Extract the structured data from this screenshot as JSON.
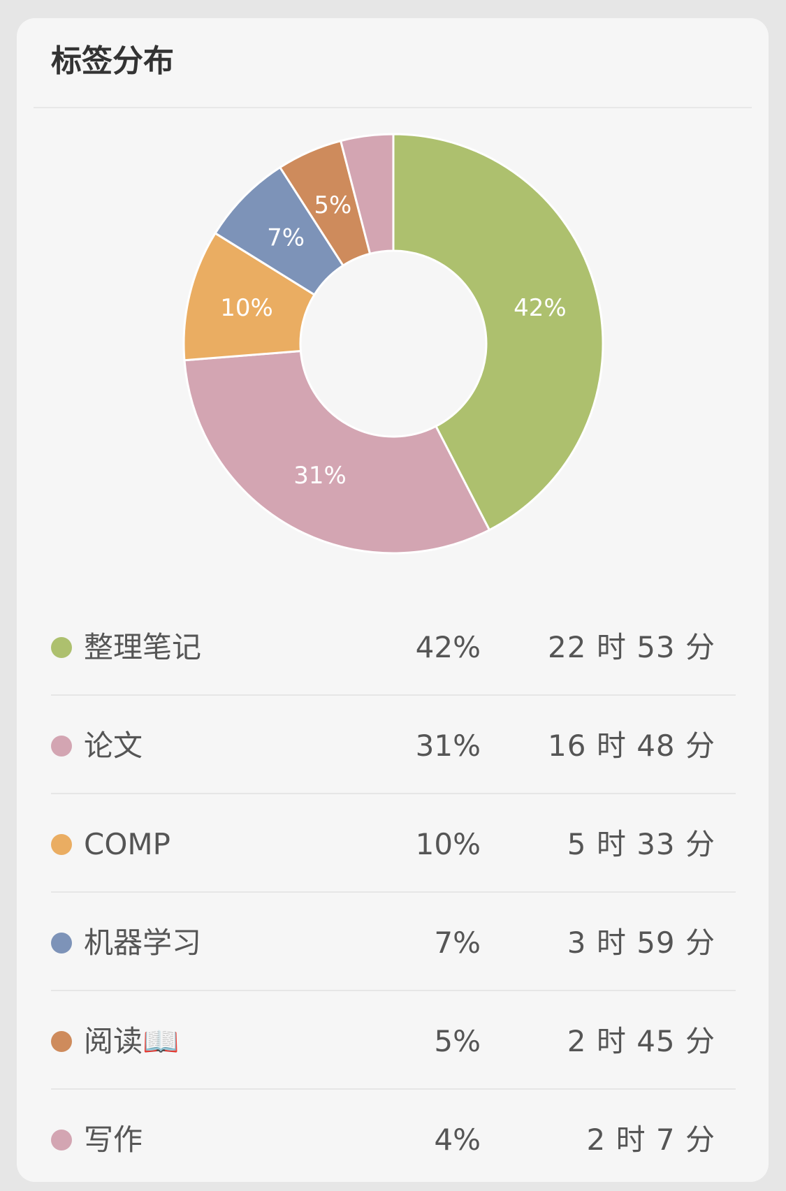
{
  "card": {
    "title": "标签分布"
  },
  "chart_data": {
    "type": "pie",
    "title": "",
    "categories": [
      "整理笔记",
      "论文",
      "COMP",
      "机器学习",
      "阅读📖",
      "写作"
    ],
    "values": [
      42,
      31,
      10,
      7,
      5,
      4
    ],
    "percent_labels": [
      "42%",
      "31%",
      "10%",
      "7%",
      "5%",
      ""
    ],
    "colors": [
      "#adc06e",
      "#d3a5b2",
      "#eaad62",
      "#7d93b8",
      "#ce8b5c",
      "#d3a5b2"
    ],
    "donut": true
  },
  "legend": {
    "rows": [
      {
        "name": "整理笔记",
        "percent": "42%",
        "duration": "22 时 53 分",
        "color": "#adc06e"
      },
      {
        "name": "论文",
        "percent": "31%",
        "duration": "16 时 48 分",
        "color": "#d3a5b2"
      },
      {
        "name": "COMP",
        "percent": "10%",
        "duration": "5 时 33 分",
        "color": "#eaad62"
      },
      {
        "name": "机器学习",
        "percent": "7%",
        "duration": "3 时 59 分",
        "color": "#7d93b8"
      },
      {
        "name": "阅读📖",
        "percent": "5%",
        "duration": "2 时 45 分",
        "color": "#ce8b5c"
      },
      {
        "name": "写作",
        "percent": "4%",
        "duration": "2 时 7 分",
        "color": "#d3a5b2"
      }
    ]
  }
}
